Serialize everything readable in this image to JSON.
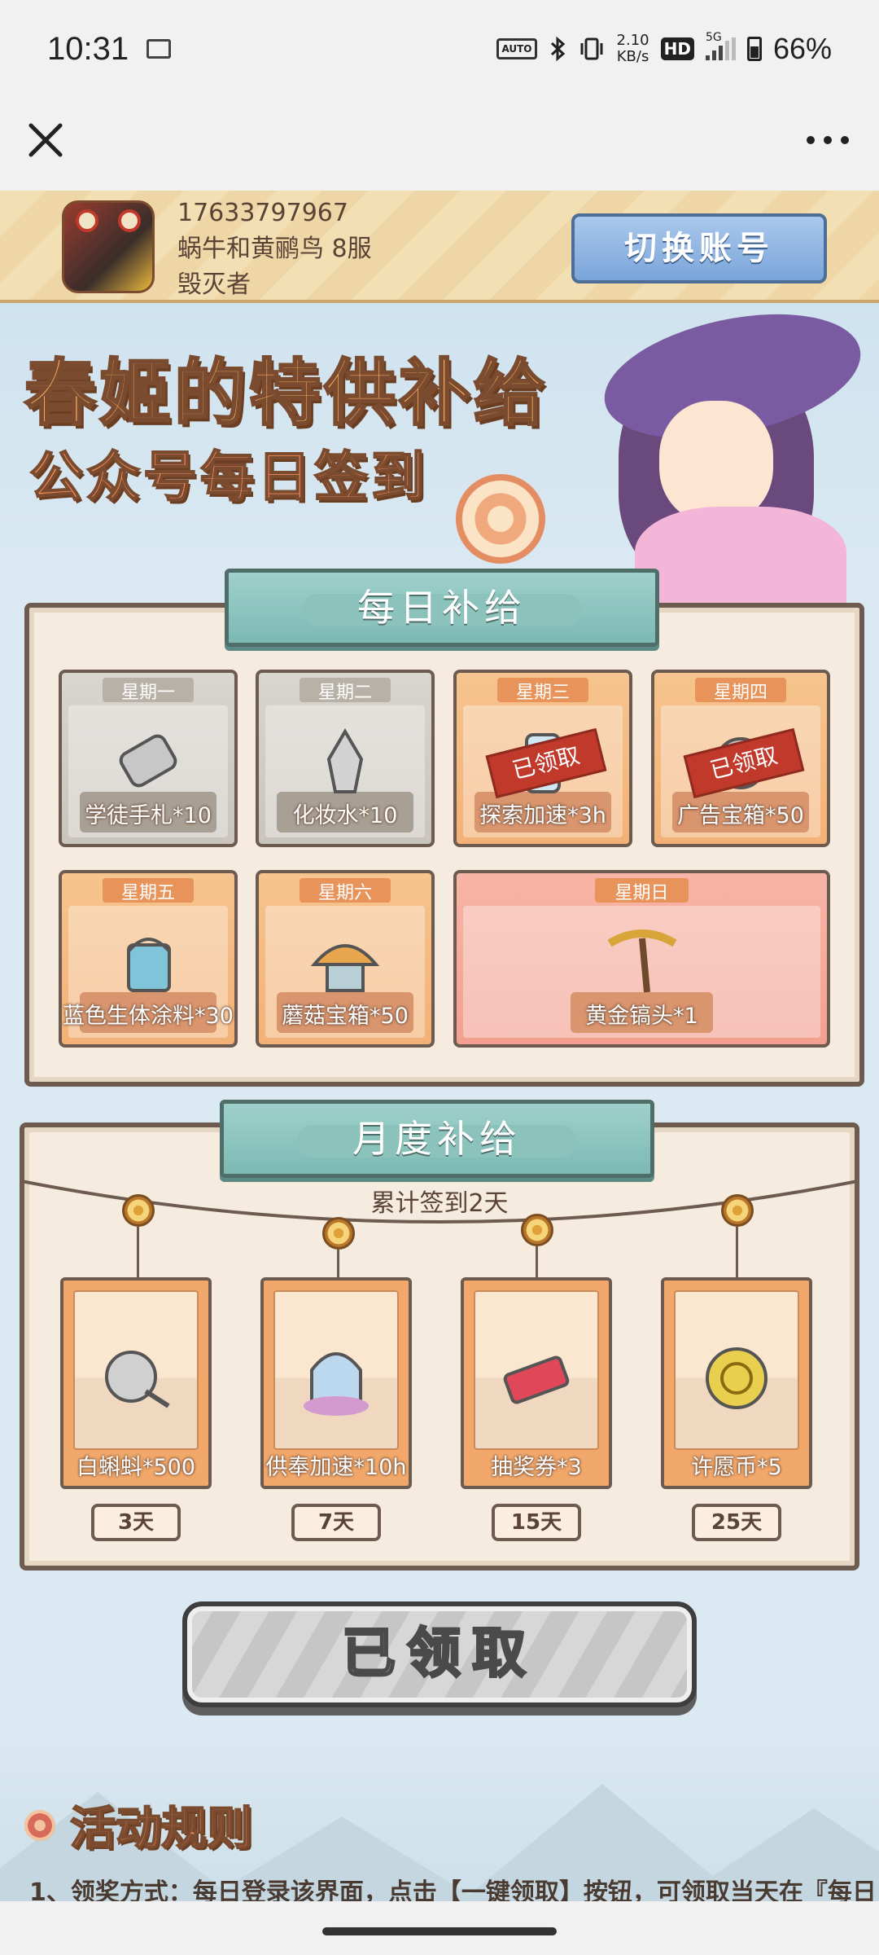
{
  "status_bar": {
    "time": "10:31",
    "speed_top": "2.10",
    "speed_bottom": "KB/s",
    "hd": "HD",
    "network": "5G",
    "battery": "66%",
    "auto_label": "AUTO"
  },
  "nav": {
    "close_icon": "close-icon",
    "more_icon": "more-icon"
  },
  "account": {
    "phone": "17633797967",
    "server": "蜗牛和黄鹂鸟 8服",
    "role": "毁灭者",
    "switch_label": "切换账号"
  },
  "hero": {
    "title": "春姬的特供补给",
    "subtitle": "公众号每日签到"
  },
  "daily": {
    "title": "每日补给",
    "claimed_label": "已领取",
    "days": [
      {
        "day": "星期一",
        "item": "学徒手札*10",
        "state": "past"
      },
      {
        "day": "星期二",
        "item": "化妆水*10",
        "state": "past"
      },
      {
        "day": "星期三",
        "item": "探索加速*3h",
        "state": "claimed"
      },
      {
        "day": "星期四",
        "item": "广告宝箱*50",
        "state": "claimed"
      },
      {
        "day": "星期五",
        "item": "蓝色生体涂料*30",
        "state": "upcoming"
      },
      {
        "day": "星期六",
        "item": "蘑菇宝箱*50",
        "state": "upcoming"
      },
      {
        "day": "星期日",
        "item": "黄金镐头*1",
        "state": "upcoming"
      }
    ]
  },
  "monthly": {
    "title": "月度补给",
    "progress_text": "累计签到2天",
    "rewards": [
      {
        "item": "白蝌蚪*500",
        "days": "3天"
      },
      {
        "item": "供奉加速*10h",
        "days": "7天"
      },
      {
        "item": "抽奖券*3",
        "days": "15天"
      },
      {
        "item": "许愿币*5",
        "days": "25天"
      }
    ]
  },
  "claim_button": "已领取",
  "rules": {
    "title": "活动规则",
    "line1": "1、领奖方式：每日登录该界面，点击【一键领取】按钮，可领取当天在『每日"
  },
  "colors": {
    "panel_border": "#6e5b50",
    "title_teal": "#7cb9b3",
    "accent_orange": "#f3a95c",
    "stamp_red": "#c0392b"
  }
}
